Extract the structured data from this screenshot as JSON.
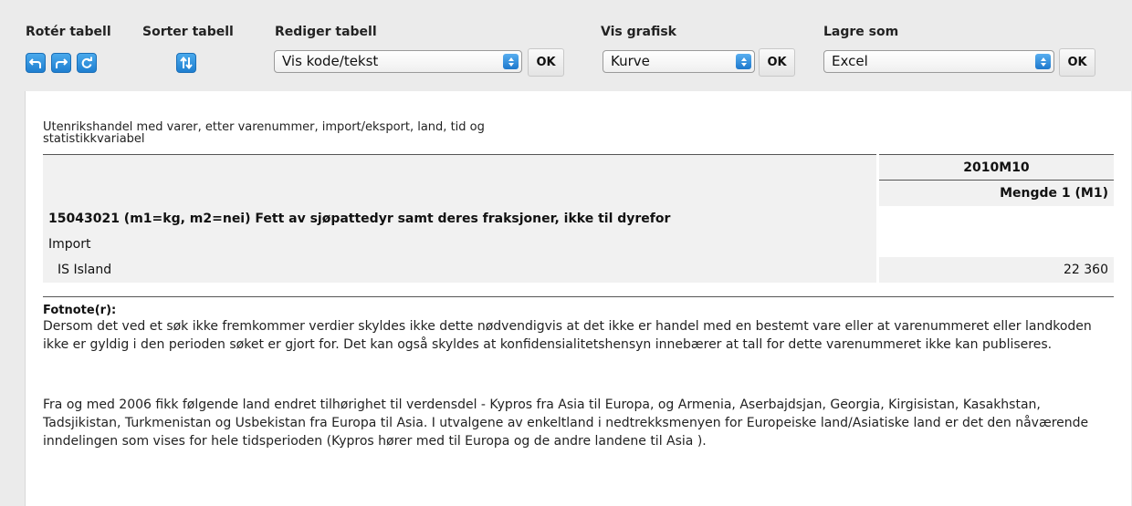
{
  "toolbar": {
    "rotate": {
      "label": "Rotér tabell"
    },
    "sort": {
      "label": "Sorter tabell"
    },
    "edit": {
      "label": "Rediger tabell",
      "selected": "Vis kode/tekst",
      "ok": "OK"
    },
    "graph": {
      "label": "Vis grafisk",
      "selected": "Kurve",
      "ok": "OK"
    },
    "save": {
      "label": "Lagre som",
      "selected": "Excel",
      "ok": "OK"
    }
  },
  "table": {
    "title": "Utenrikshandel med varer, etter varenummer, import/eksport, land, tid og statistikkvariabel",
    "period": "2010M10",
    "variable": "Mengde 1 (M1)",
    "commodity": "15043021 (m1=kg, m2=nei) Fett av sjøpattedyr samt deres fraksjoner, ikke til dyrefor",
    "direction": "Import",
    "country": "IS Island",
    "value": "22 360"
  },
  "footnotes": {
    "heading": "Fotnote(r):",
    "note1": "Dersom det ved et søk ikke fremkommer verdier skyldes ikke dette nødvendigvis at det ikke er handel med en bestemt vare eller at varenummeret eller landkoden ikke er gyldig i den perioden søket er gjort for. Det kan også skyldes at konfidensialitetshensyn innebærer at tall for dette varenummeret ikke kan publiseres.",
    "note2": "Fra og med 2006 fikk følgende land endret tilhørighet til verdensdel - Kypros fra Asia til Europa, og Armenia, Aserbajdsjan, Georgia, Kirgisistan, Kasakhstan, Tadsjikistan, Turkmenistan og Usbekistan fra Europa til Asia. I utvalgene av enkeltland i nedtrekksmenyen for Europeiske land/Asiatiske land er det den nåværende inndelingen som vises for hele tidsperioden (Kypros hører med til Europa og de andre landene til Asia )."
  },
  "icons": [
    "rotate-left-icon",
    "rotate-right-icon",
    "refresh-icon",
    "sort-icon",
    "select-arrows-icon"
  ],
  "colors": {
    "icon_blue": "#1f7fd0",
    "header_bg": "#f1f1f1",
    "toolbar_bg": "#ebebeb"
  }
}
